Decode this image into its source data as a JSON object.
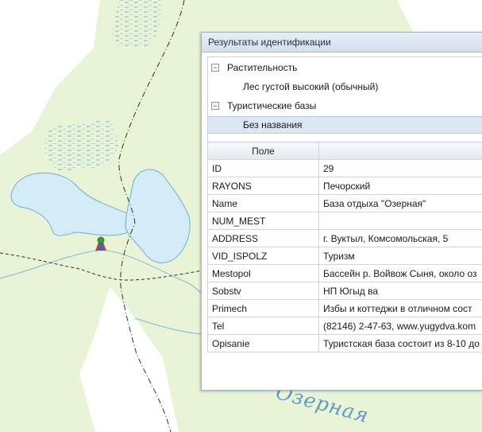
{
  "map": {
    "lake_label": "Озерная"
  },
  "panel": {
    "title": "Результаты идентификации",
    "tree": [
      {
        "label": "Растительность",
        "expander": "−"
      },
      {
        "label": "Лес густой высокий (обычный)"
      },
      {
        "label": "Туристические базы",
        "expander": "−"
      },
      {
        "label": "Без названия"
      }
    ],
    "grid": {
      "headers": [
        "Поле",
        ""
      ],
      "rows": [
        [
          "ID",
          "29"
        ],
        [
          "RAYONS",
          "Печорский"
        ],
        [
          "Name",
          "База отдыха \"Озерная\""
        ],
        [
          "NUM_MEST",
          ""
        ],
        [
          "ADDRESS",
          "г. Вуктыл, Комсомольская, 5"
        ],
        [
          "VID_ISPOLZ",
          "Туризм"
        ],
        [
          "Mestopol",
          "Бассейн р. Войвож Сыня, около оз"
        ],
        [
          "Sobstv",
          "НП Югыд ва"
        ],
        [
          "Primech",
          "Избы и коттеджи в отличном сост"
        ],
        [
          "Tel",
          "(82146) 2-47-63, www.yugydva.kom"
        ],
        [
          "Opisanie",
          "Туристская база состоит из 8-10 до"
        ]
      ]
    }
  },
  "colors": {
    "land": "#e9f4d6",
    "water": "#d4ecf7",
    "water_outline": "#6aaed6",
    "white_area": "#ffffff",
    "selection": "#dbe7f5"
  }
}
